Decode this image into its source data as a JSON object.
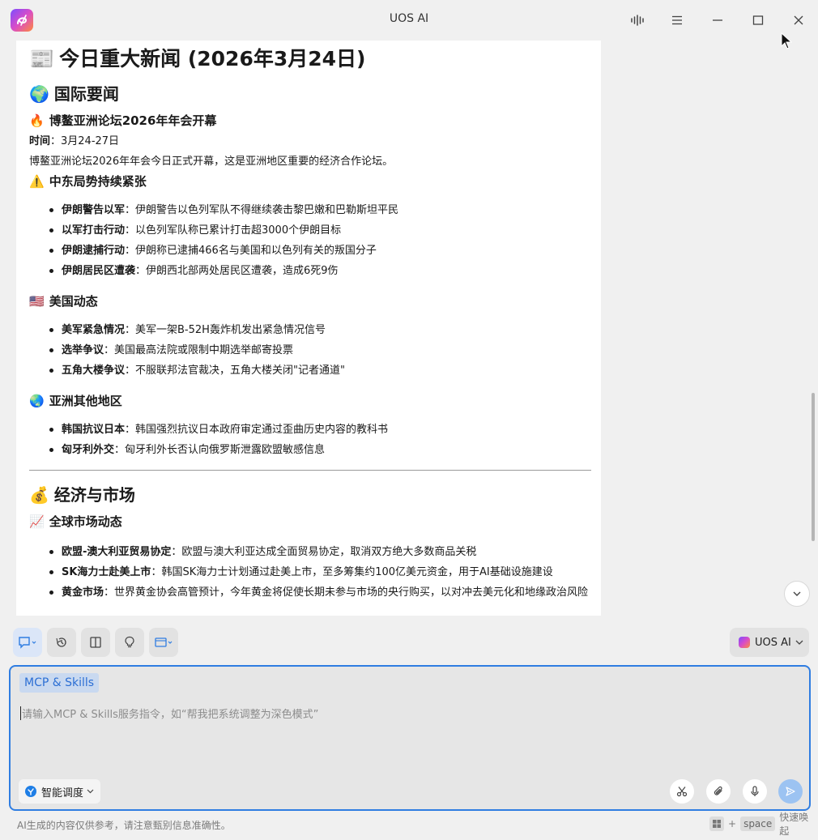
{
  "window": {
    "title": "UOS AI"
  },
  "article": {
    "title": "今日重大新闻 (2026年3月24日)",
    "sections": {
      "intl": {
        "heading": "国际要闻",
        "boao": {
          "heading": "博鳌亚洲论坛2026年年会开幕",
          "time_label": "时间",
          "time_value": "：3月24-27日",
          "desc": "博鳌亚洲论坛2026年年会今日正式开幕，这是亚洲地区重要的经济合作论坛。"
        },
        "mideast": {
          "heading": "中东局势持续紧张",
          "items": [
            {
              "label": "伊朗警告以军",
              "text": "：伊朗警告以色列军队不得继续袭击黎巴嫩和巴勒斯坦平民"
            },
            {
              "label": "以军打击行动",
              "text": "：以色列军队称已累计打击超3000个伊朗目标"
            },
            {
              "label": "伊朗逮捕行动",
              "text": "：伊朗称已逮捕466名与美国和以色列有关的叛国分子"
            },
            {
              "label": "伊朗居民区遭袭",
              "text": "：伊朗西北部两处居民区遭袭，造成6死9伤"
            }
          ]
        },
        "us": {
          "heading": "美国动态",
          "items": [
            {
              "label": "美军紧急情况",
              "text": "：美军一架B-52H轰炸机发出紧急情况信号"
            },
            {
              "label": "选举争议",
              "text": "：美国最高法院或限制中期选举邮寄投票"
            },
            {
              "label": "五角大楼争议",
              "text": "：不服联邦法官裁决，五角大楼关闭\"记者通道\""
            }
          ]
        },
        "asia": {
          "heading": "亚洲其他地区",
          "items": [
            {
              "label": "韩国抗议日本",
              "text": "：韩国强烈抗议日本政府审定通过歪曲历史内容的教科书"
            },
            {
              "label": "匈牙利外交",
              "text": "：匈牙利外长否认向俄罗斯泄露欧盟敏感信息"
            }
          ]
        }
      },
      "econ": {
        "heading": "经济与市场",
        "market": {
          "heading": "全球市场动态",
          "items": [
            {
              "label": "欧盟-澳大利亚贸易协定",
              "text": "：欧盟与澳大利亚达成全面贸易协定，取消双方绝大多数商品关税"
            },
            {
              "label": "SK海力士赴美上市",
              "text": "：韩国SK海力士计划通过赴美上市，至多筹集约100亿美元资金，用于AI基础设施建设"
            },
            {
              "label": "黄金市场",
              "text": "：世界黄金协会高管预计，今年黄金将促使长期未参与市场的央行购买，以对冲去美元化和地缘政治风险"
            }
          ]
        }
      }
    }
  },
  "model_selector": {
    "label": "UOS AI"
  },
  "input": {
    "chip": "MCP & Skills",
    "placeholder": "请输入MCP & Skills服务指令，如“帮我把系统调整为深色模式”",
    "schedule_label": "智能调度"
  },
  "footer": {
    "note": "AI生成的内容仅供参考，请注意甄别信息准确性。",
    "shortcut_plus": "+",
    "shortcut_key": "space",
    "shortcut_label": "快速唤起"
  },
  "colors": {
    "accent": "#2f7de1",
    "chip_bg": "#c9d9f0",
    "send_disabled": "#9cc3f2"
  },
  "icons": {
    "app": "uos-ai-logo-icon",
    "wave": "voice-wave-icon",
    "menu": "hamburger-menu-icon",
    "minimize": "minimize-icon",
    "maximize": "maximize-icon",
    "close": "close-icon"
  }
}
